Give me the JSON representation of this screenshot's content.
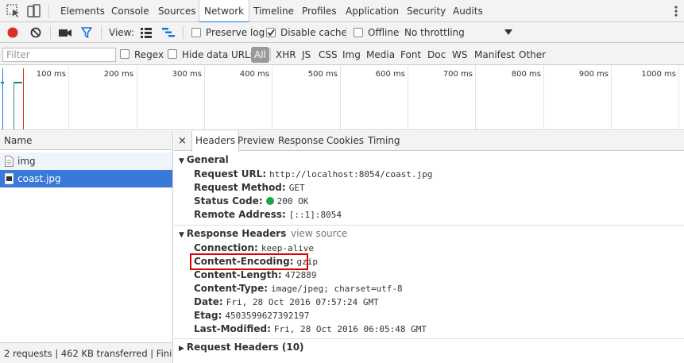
{
  "tabs": [
    "Elements",
    "Console",
    "Sources",
    "Network",
    "Timeline",
    "Profiles",
    "Application",
    "Security",
    "Audits"
  ],
  "active_tab": "Network",
  "toolbar": {
    "view_label": "View:",
    "preserve_log": "Preserve log",
    "disable_cache": "Disable cache",
    "offline": "Offline",
    "throttling": "No throttling",
    "accent_color": "#d93025",
    "filter_icon_color": "#1a73e8"
  },
  "filter": {
    "placeholder": "Filter",
    "regex": "Regex",
    "hide_data_urls": "Hide data URLs",
    "types": [
      "All",
      "XHR",
      "JS",
      "CSS",
      "Img",
      "Media",
      "Font",
      "Doc",
      "WS",
      "Manifest",
      "Other"
    ]
  },
  "timeline": {
    "ticks": [
      "100 ms",
      "200 ms",
      "300 ms",
      "400 ms",
      "500 ms",
      "600 ms",
      "700 ms",
      "800 ms",
      "900 ms",
      "1000 ms"
    ]
  },
  "requests": {
    "header": "Name",
    "rows": [
      {
        "name": "img"
      },
      {
        "name": "coast.jpg"
      }
    ],
    "summary": "2 requests  |  462 KB transferred  |  Fini..."
  },
  "details": {
    "close": "×",
    "tabs": [
      "Headers",
      "Preview",
      "Response",
      "Cookies",
      "Timing"
    ],
    "general": {
      "title": "General",
      "request_url_k": "Request URL:",
      "request_url_v": "http://localhost:8054/coast.jpg",
      "method_k": "Request Method:",
      "method_v": "GET",
      "status_k": "Status Code:",
      "status_v": "200 OK",
      "status_color": "#1ea446",
      "remote_k": "Remote Address:",
      "remote_v": "[::1]:8054"
    },
    "response_headers": {
      "title": "Response Headers",
      "view_source": "view source",
      "items": [
        {
          "k": "Connection:",
          "v": "keep-alive"
        },
        {
          "k": "Content-Encoding:",
          "v": "gzip"
        },
        {
          "k": "Content-Length:",
          "v": "472889"
        },
        {
          "k": "Content-Type:",
          "v": "image/jpeg; charset=utf-8"
        },
        {
          "k": "Date:",
          "v": "Fri, 28 Oct 2016 07:57:24 GMT"
        },
        {
          "k": "Etag:",
          "v": "4503599627392197"
        },
        {
          "k": "Last-Modified:",
          "v": "Fri, 28 Oct 2016 06:05:48 GMT"
        }
      ]
    },
    "request_headers": {
      "title": "Request Headers (10)"
    }
  }
}
